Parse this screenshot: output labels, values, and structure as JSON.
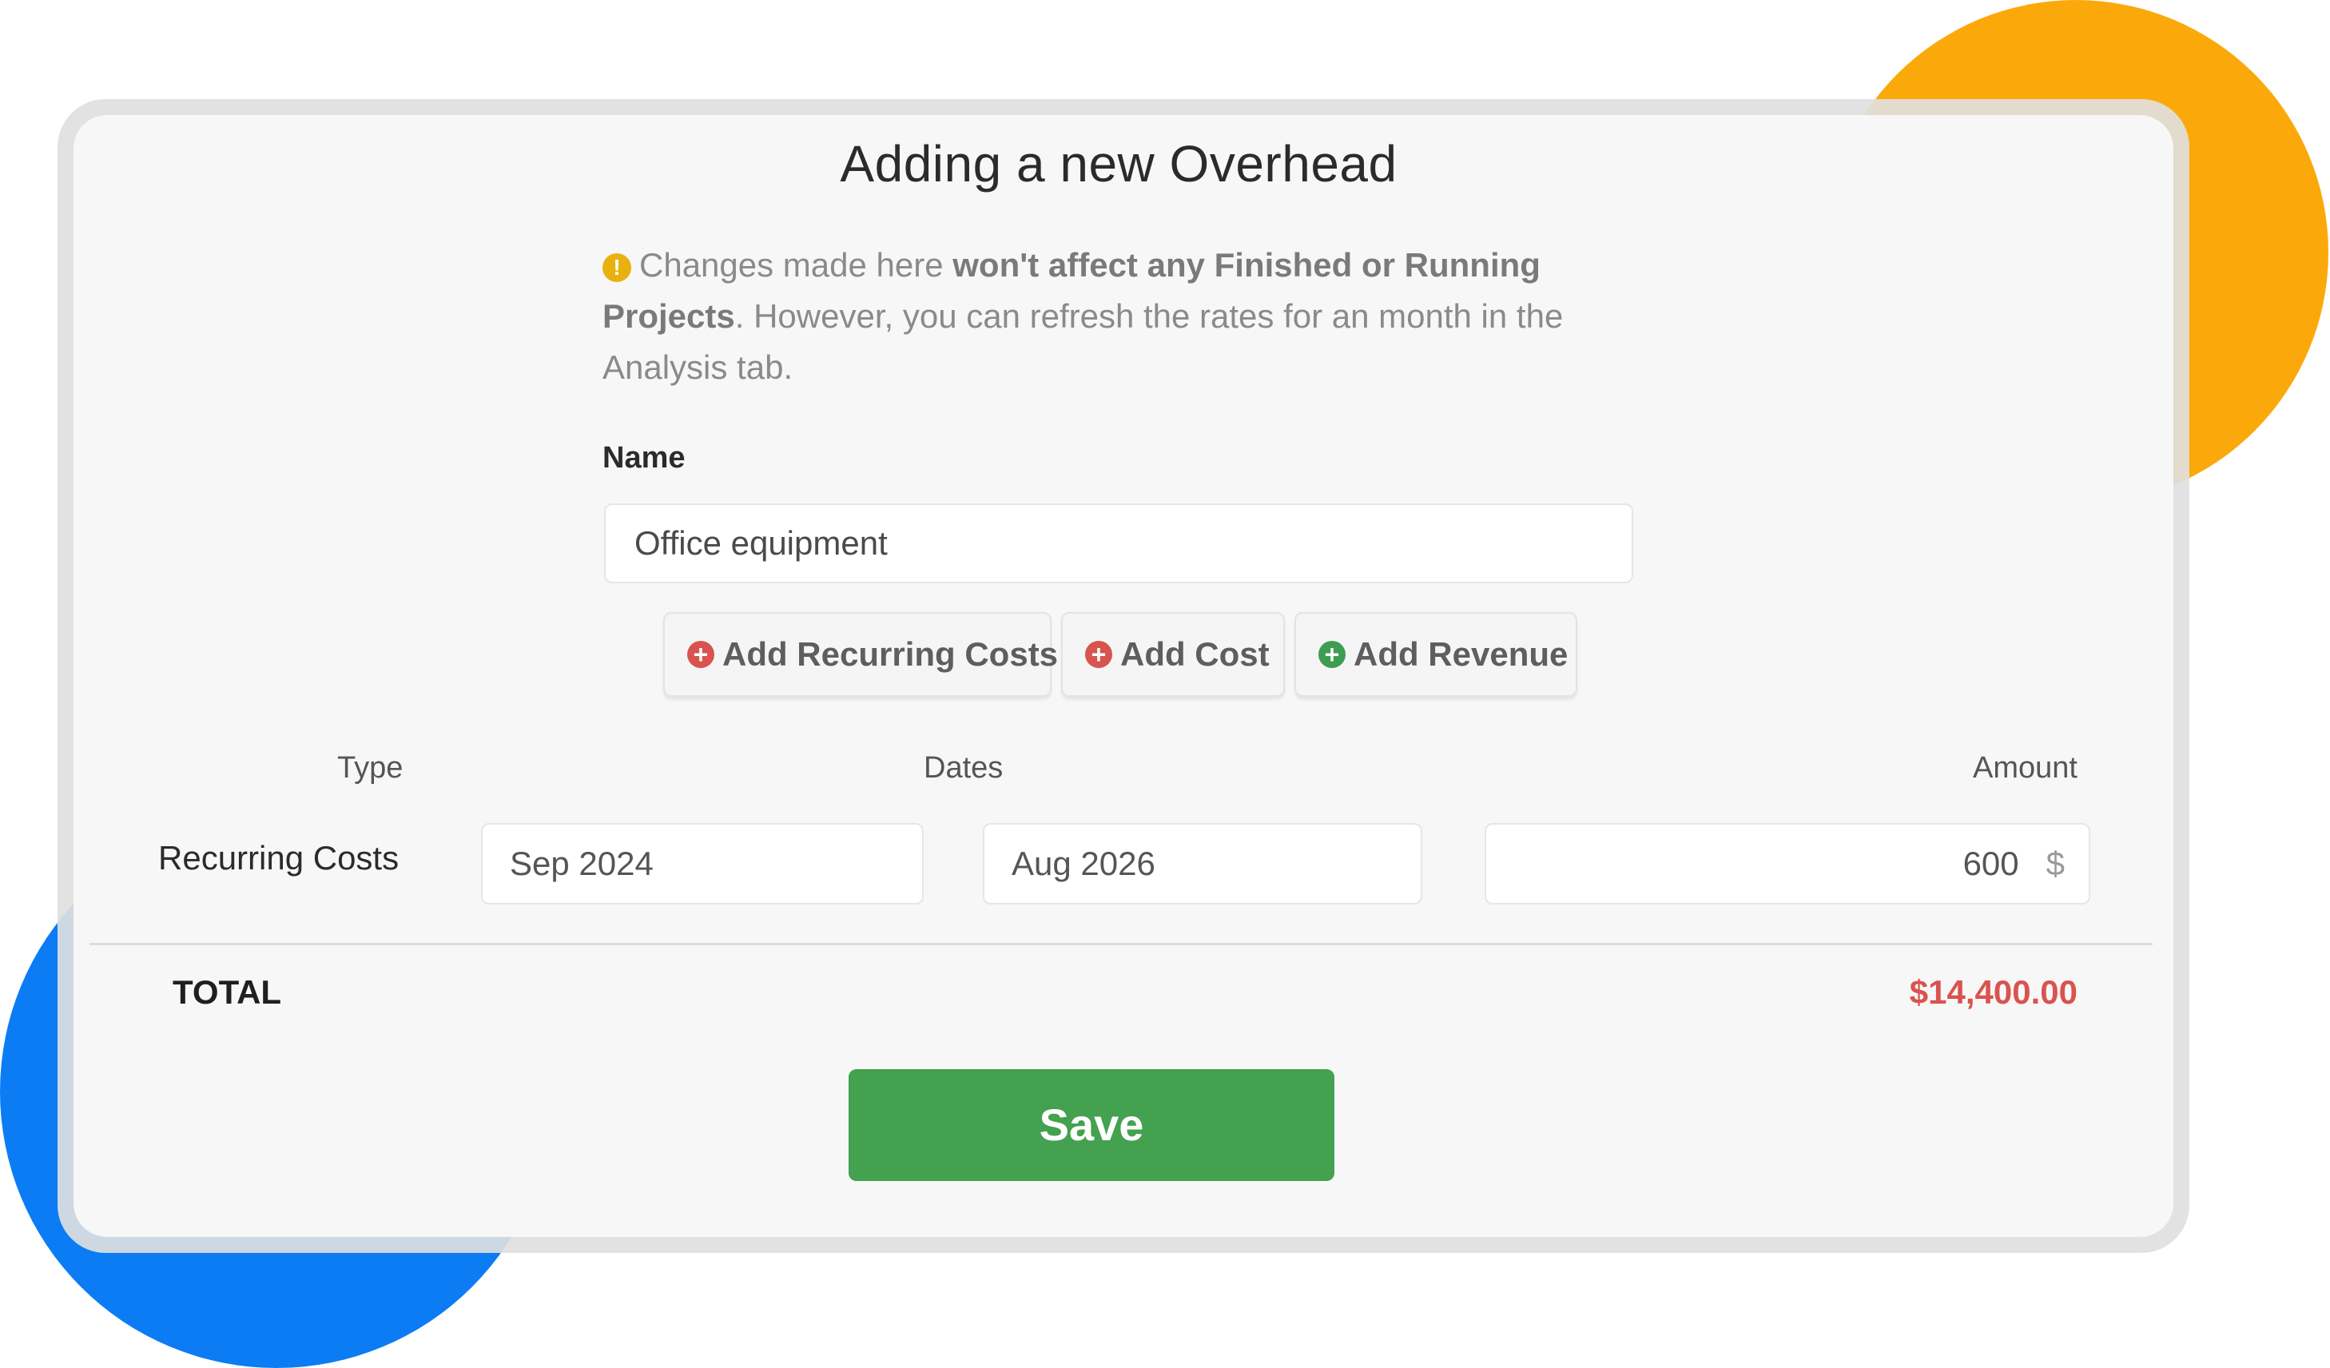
{
  "modal": {
    "title": "Adding a new Overhead",
    "notice": {
      "icon": "alert-circle-icon",
      "text_before": "Changes made here ",
      "text_bold": "won't affect any Finished or Running Projects",
      "text_after": ". However, you can refresh the rates for an month in the Analysis tab."
    },
    "name_label": "Name",
    "name_value": "Office equipment"
  },
  "actions": {
    "add_recurring_label": "Add Recurring Costs",
    "add_cost_label": "Add Cost",
    "add_revenue_label": "Add Revenue",
    "plus_glyph": "+"
  },
  "table": {
    "headers": {
      "type": "Type",
      "dates": "Dates",
      "amount": "Amount"
    },
    "rows": [
      {
        "type": "Recurring Costs",
        "start": "Sep 2024",
        "end": "Aug 2026",
        "amount": "600",
        "currency": "$"
      }
    ]
  },
  "total": {
    "label": "TOTAL",
    "value": "$14,400.00"
  },
  "save_label": "Save",
  "colors": {
    "accent_green": "#43A150",
    "danger_red": "#D9534F",
    "warning_yellow": "#E8B10E",
    "decor_orange": "#FBA90A",
    "decor_blue": "#0B7CF4"
  }
}
